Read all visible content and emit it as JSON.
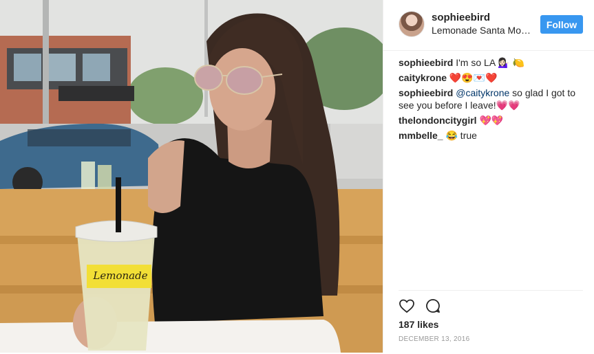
{
  "post": {
    "username": "sophieebird",
    "location": "Lemonade Santa Monica",
    "follow_label": "Follow",
    "colors": {
      "follow_button": "#3897f0",
      "mention": "#003569",
      "date": "#999999"
    },
    "photo": {
      "cup_text": "Lemonade"
    }
  },
  "comments": [
    {
      "user": "sophieebird",
      "text": " I'm so LA 💁🏻‍♀️ 🍋"
    },
    {
      "user": "caitykrone",
      "text": " ❤️😍💌❤️"
    },
    {
      "user": "sophieebird",
      "mention": "@caitykrone",
      "text": " so glad I got to see you before I leave!💗💗"
    },
    {
      "user": "thelondoncitygirl",
      "text": " 💖💖"
    },
    {
      "user": "mmbelle_",
      "text": " 😂 true"
    }
  ],
  "actions": {
    "like_icon": "heart-outline-icon",
    "comment_icon": "comment-bubble-icon",
    "likes": "187 likes",
    "date": "DECEMBER 13, 2016"
  }
}
